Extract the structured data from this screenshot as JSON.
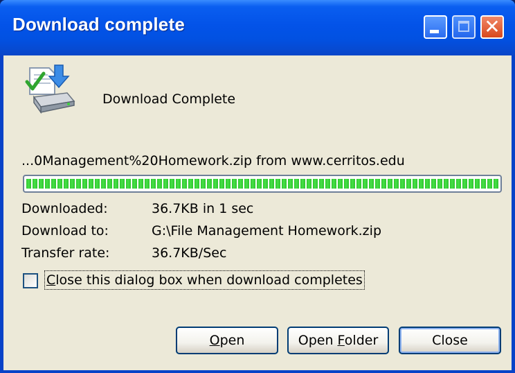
{
  "window": {
    "title": "Download complete",
    "controls": {
      "minimize": "minimize",
      "maximize": "maximize",
      "close": "close"
    }
  },
  "header": {
    "icon": "download-complete-icon",
    "status_text": "Download Complete"
  },
  "download": {
    "source_text": "...0Management%20Homework.zip from www.cerritos.edu",
    "progress_fraction": 1.0,
    "details": [
      {
        "label": "Downloaded:",
        "value": "36.7KB in 1 sec"
      },
      {
        "label": "Download to:",
        "value": "G:\\File Management Homework.zip"
      },
      {
        "label": "Transfer rate:",
        "value": "36.7KB/Sec"
      }
    ]
  },
  "options": {
    "close_on_complete": {
      "label_first": "C",
      "label_rest": "lose this dialog box when download completes",
      "checked": false
    }
  },
  "buttons": {
    "open": {
      "mnemonic": "O",
      "rest": "pen"
    },
    "open_folder": {
      "prefix": "Open ",
      "mnemonic": "F",
      "rest": "older"
    },
    "close": {
      "label": "Close"
    }
  },
  "colors": {
    "titlebar": "#0353E8",
    "client_bg": "#ECE9D8",
    "progress_green": "#2CC52C",
    "close_button": "#D9481C"
  }
}
